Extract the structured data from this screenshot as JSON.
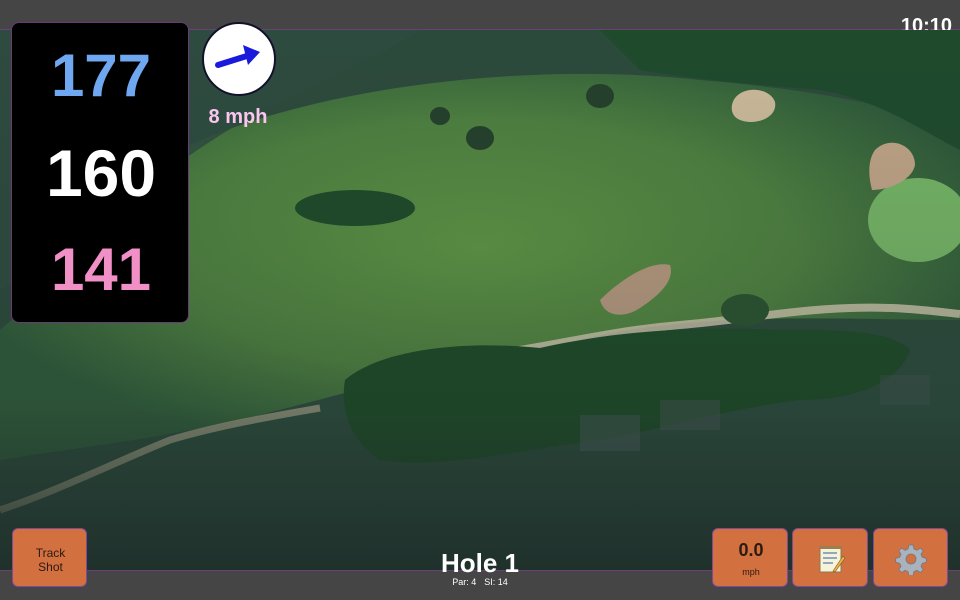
{
  "status_bar": {
    "time": "10:10"
  },
  "distances": {
    "back": "177",
    "middle": "160",
    "front": "141"
  },
  "wind": {
    "speed": "8 mph",
    "icon": "wind-direction-arrow-icon",
    "color": "#1a1adc"
  },
  "hole": {
    "title": "Hole 1",
    "par": "Par: 4",
    "stroke_index": "SI: 14"
  },
  "buttons": {
    "track_shot_line1": "Track",
    "track_shot_line2": "Shot",
    "speed_value": "0.0",
    "speed_unit": "mph",
    "notes_icon": "notepad-icon",
    "settings_icon": "gear-icon"
  },
  "colors": {
    "button": "#d2703f",
    "back_distance": "#6fa8f0",
    "middle_distance": "#ffffff",
    "front_distance": "#f190c6",
    "wind_speed": "#fbc6ee",
    "accent_border": "#6a3f7a"
  }
}
